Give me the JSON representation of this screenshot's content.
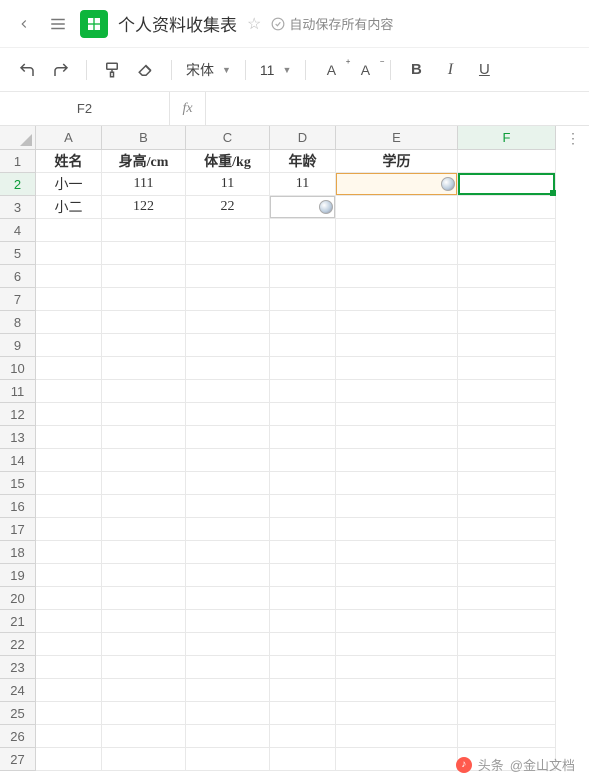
{
  "doc": {
    "title": "个人资料收集表",
    "autosave": "自动保存所有内容"
  },
  "toolbar": {
    "font": "宋体",
    "size": "11",
    "bold": "B",
    "italic": "I",
    "underline": "U",
    "Aplus": "A",
    "Aminus": "A"
  },
  "fx": {
    "cellref": "F2",
    "label": "fx",
    "value": ""
  },
  "columns": [
    "A",
    "B",
    "C",
    "D",
    "E",
    "F"
  ],
  "active_column": "F",
  "active_row": 2,
  "row_count": 27,
  "headers": {
    "A": "姓名",
    "B": "身高/cm",
    "C": "体重/kg",
    "D": "年龄",
    "E": "学历"
  },
  "rows": [
    {
      "A": "小一",
      "B": "111",
      "C": "11",
      "D": "11",
      "E": ""
    },
    {
      "A": "小二",
      "B": "122",
      "C": "22",
      "D": "",
      "E": ""
    }
  ],
  "watermark": {
    "prefix": "头条",
    "handle": "@金山文档"
  }
}
